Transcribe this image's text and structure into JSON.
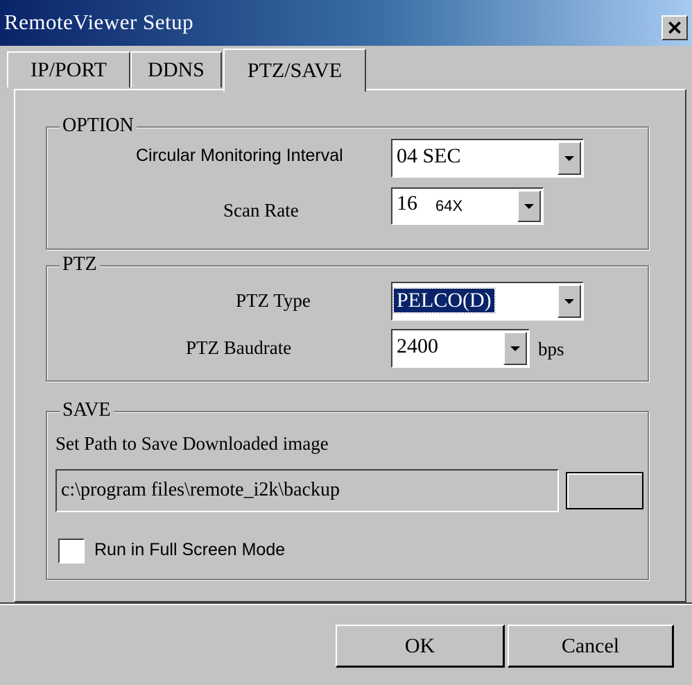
{
  "window": {
    "title": "RemoteViewer Setup",
    "close_icon": "close-icon"
  },
  "tabs": [
    {
      "label": "IP/PORT",
      "active": false
    },
    {
      "label": "DDNS",
      "active": false
    },
    {
      "label": "PTZ/SAVE",
      "active": true
    }
  ],
  "option": {
    "group_label": "OPTION",
    "circular_label": "Circular Monitoring Interval",
    "circular_value": "04 SEC",
    "scan_label": "Scan Rate",
    "scan_value_a": "16",
    "scan_value_b": "64X"
  },
  "ptz": {
    "group_label": "PTZ",
    "type_label": "PTZ Type",
    "type_value": "PELCO(D)",
    "baud_label": "PTZ Baudrate",
    "baud_value": "2400",
    "baud_unit": "bps"
  },
  "save": {
    "group_label": "SAVE",
    "path_label": "Set Path to Save Downloaded image",
    "path_value": "c:\\program files\\remote_i2k\\backup",
    "browse_label": "",
    "fullscreen_label": "Run in Full Screen Mode",
    "fullscreen_checked": false
  },
  "buttons": {
    "ok": "OK",
    "cancel": "Cancel"
  }
}
